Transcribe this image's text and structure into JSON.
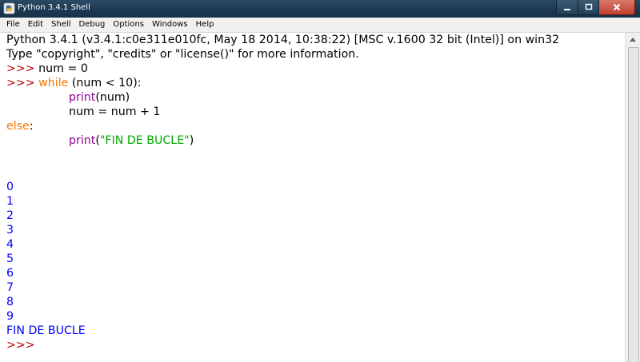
{
  "window": {
    "title": "Python 3.4.1 Shell"
  },
  "menu": [
    "File",
    "Edit",
    "Shell",
    "Debug",
    "Options",
    "Windows",
    "Help"
  ],
  "shell": {
    "banner1": "Python 3.4.1 (v3.4.1:c0e311e010fc, May 18 2014, 10:38:22) [MSC v.1600 32 bit (Intel)] on win32",
    "banner2": "Type \"copyright\", \"credits\" or \"license()\" for more information.",
    "prompt": ">>>",
    "cmd1": " num = 0",
    "cmd2_kw": " while",
    "cmd2_rest": " (num < 10):",
    "body1_fn": "print",
    "body1_rest": "(num)",
    "body2": "num = num + 1",
    "else_kw": "else",
    "else_colon": ":",
    "body3_fn": "print",
    "body3_open": "(",
    "body3_str": "\"FIN DE BUCLE\"",
    "body3_close": ")",
    "output": [
      "0",
      "1",
      "2",
      "3",
      "4",
      "5",
      "6",
      "7",
      "8",
      "9",
      "FIN DE BUCLE"
    ]
  },
  "colors": {
    "prompt": "#c00000",
    "keyword": "#ff7700",
    "builtin": "#900090",
    "string": "#00aa00",
    "output": "#0000ff"
  }
}
